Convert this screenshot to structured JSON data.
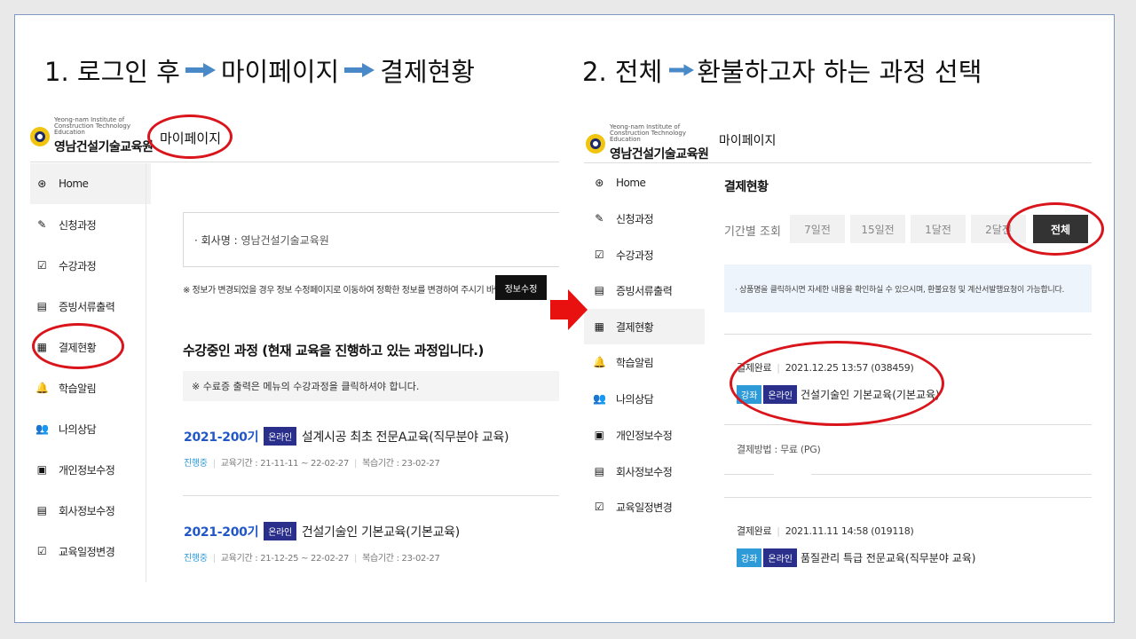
{
  "steps": [
    {
      "text_a": "1. 로그인 후",
      "text_b": "마이페이지",
      "text_c": "결제현황"
    },
    {
      "text_a": "2. 전체",
      "text_b": "환불하고자 하는 과정 선택"
    }
  ],
  "colors": {
    "accent_red": "#d9141b",
    "arrow_blue": "#4a89c8",
    "badge_online": "#2a2f8c",
    "badge_cat": "#2e9bd8",
    "link_blue": "#2257c8"
  },
  "logo": {
    "sub": "Yeong-nam Institute of Construction Technology Education",
    "main": "영남건설기술교육원"
  },
  "panel1": {
    "header_title": "마이페이지",
    "sidebar": [
      {
        "label": "Home",
        "icon": "home-icon",
        "glyph": "⊛"
      },
      {
        "label": "신청과정",
        "icon": "pen-icon",
        "glyph": "✎"
      },
      {
        "label": "수강과정",
        "icon": "checklist-icon",
        "glyph": "☑"
      },
      {
        "label": "증빙서류출력",
        "icon": "document-icon",
        "glyph": "▤"
      },
      {
        "label": "결제현황",
        "icon": "calculator-icon",
        "glyph": "▦"
      },
      {
        "label": "학습알림",
        "icon": "bell-icon",
        "glyph": "🔔"
      },
      {
        "label": "나의상담",
        "icon": "users-icon",
        "glyph": "👥"
      },
      {
        "label": "개인정보수정",
        "icon": "id-card-icon",
        "glyph": "▣"
      },
      {
        "label": "회사정보수정",
        "icon": "document-icon",
        "glyph": "▤"
      },
      {
        "label": "교육일정변경",
        "icon": "checklist-icon",
        "glyph": "☑"
      }
    ],
    "company_label": "· 회사명 :",
    "company_value": "영남건설기술교육원",
    "info_note": "※ 정보가 변경되었을 경우 정보 수정페이지로 이동하여 정확한 정보를 변경하여 주시기 바랍니다",
    "edit_button": "정보수정",
    "section_title": "수강중인 과정 (현재 교육을 진행하고 있는 과정입니다.)",
    "section_note": "※ 수료증 출력은 메뉴의 수강과정을 클릭하셔야 합니다.",
    "courses": [
      {
        "term": "2021-200기",
        "badge": "온라인",
        "title": "설계시공 최초 전문A교육(직무분야 교육)",
        "status": "진행중",
        "period": "교육기간 : 21-11-11 ~ 22-02-27",
        "review": "복습기간 : 23-02-27"
      },
      {
        "term": "2021-200기",
        "badge": "온라인",
        "title": "건설기술인 기본교육(기본교육)",
        "status": "진행중",
        "period": "교육기간 : 21-12-25 ~ 22-02-27",
        "review": "복습기간 : 23-02-27"
      }
    ]
  },
  "panel2": {
    "header_title": "마이페이지",
    "sidebar": [
      {
        "label": "Home",
        "icon": "home-icon",
        "glyph": "⊛"
      },
      {
        "label": "신청과정",
        "icon": "pen-icon",
        "glyph": "✎"
      },
      {
        "label": "수강과정",
        "icon": "checklist-icon",
        "glyph": "☑"
      },
      {
        "label": "증빙서류출력",
        "icon": "document-icon",
        "glyph": "▤"
      },
      {
        "label": "결제현황",
        "icon": "calculator-icon",
        "glyph": "▦"
      },
      {
        "label": "학습알림",
        "icon": "bell-icon",
        "glyph": "🔔"
      },
      {
        "label": "나의상담",
        "icon": "users-icon",
        "glyph": "👥"
      },
      {
        "label": "개인정보수정",
        "icon": "id-card-icon",
        "glyph": "▣"
      },
      {
        "label": "회사정보수정",
        "icon": "document-icon",
        "glyph": "▤"
      },
      {
        "label": "교육일정변경",
        "icon": "checklist-icon",
        "glyph": "☑"
      }
    ],
    "page_title": "결제현황",
    "filter_label": "기간별 조회",
    "filters": [
      "7일전",
      "15일전",
      "1달전",
      "2달전",
      "전체"
    ],
    "notice": "· 상품명을 클릭하시면 자세한 내용을 확인하실 수 있으시며, 환불요청 및 계산서발행요청이 가능합니다.",
    "payments": [
      {
        "status": "결제완료",
        "datetime": "2021.12.25 13:57 (038459)",
        "cat": "강좌",
        "badge": "온라인",
        "title": "건설기술인 기본교육(기본교육)",
        "method": "결제방법 : 무료 (PG)"
      },
      {
        "status": "결제완료",
        "datetime": "2021.11.11 14:58 (019118)",
        "cat": "강좌",
        "badge": "온라인",
        "title": "품질관리 특급 전문교육(직무분야 교육)"
      }
    ]
  }
}
